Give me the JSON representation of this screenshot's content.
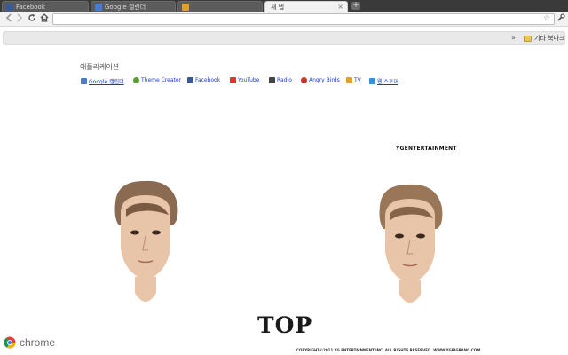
{
  "tabs": [
    {
      "label": "Facebook",
      "favicon_color": "#3b5998",
      "active": false
    },
    {
      "label": "Google 캘린더",
      "favicon_color": "#4a7bd0",
      "active": false
    },
    {
      "label": "",
      "favicon_color": "#e0a030",
      "active": false
    },
    {
      "label": "새 탭",
      "favicon_color": "",
      "active": true
    }
  ],
  "tab_close_glyph": "×",
  "new_tab_glyph": "+",
  "toolbar": {
    "back_icon": "back-arrow-icon",
    "forward_icon": "forward-arrow-icon",
    "reload_icon": "reload-icon",
    "home_icon": "home-icon",
    "omnibox_value": "",
    "star_icon": "star-icon",
    "wrench_icon": "wrench-icon"
  },
  "bookmarks_bar": {
    "chevron": "»",
    "other_bookmarks_label": "기타 북마크"
  },
  "apps_section": {
    "title": "애플리케이션",
    "apps": [
      {
        "label": "Google 캘린더",
        "icon_color": "#4a7bd0"
      },
      {
        "label": "Theme Creator",
        "icon_color": "#5aa02c"
      },
      {
        "label": "Facebook",
        "icon_color": "#3b5998"
      },
      {
        "label": "YouTube",
        "icon_color": "#d33"
      },
      {
        "label": "Radio",
        "icon_color": "#444"
      },
      {
        "label": "Angry Birds",
        "icon_color": "#c33"
      },
      {
        "label": "TV",
        "icon_color": "#e0a030"
      },
      {
        "label": "웹 스토어",
        "icon_color": "#3a8fd6"
      }
    ]
  },
  "theme": {
    "label_brand": "ENTERTAINMENT",
    "label_brand_prefix": "YG",
    "title": "TOP",
    "copyright": "COPYRIGHT©2011 YG ENTERTAINMENT INC. ALL RIGHTS RESERVED. WWW.YGBIGBANG.COM",
    "skin_color": "#e8c4a8",
    "hair_color": "#8a6a50"
  },
  "brand": {
    "text": "chrome"
  }
}
